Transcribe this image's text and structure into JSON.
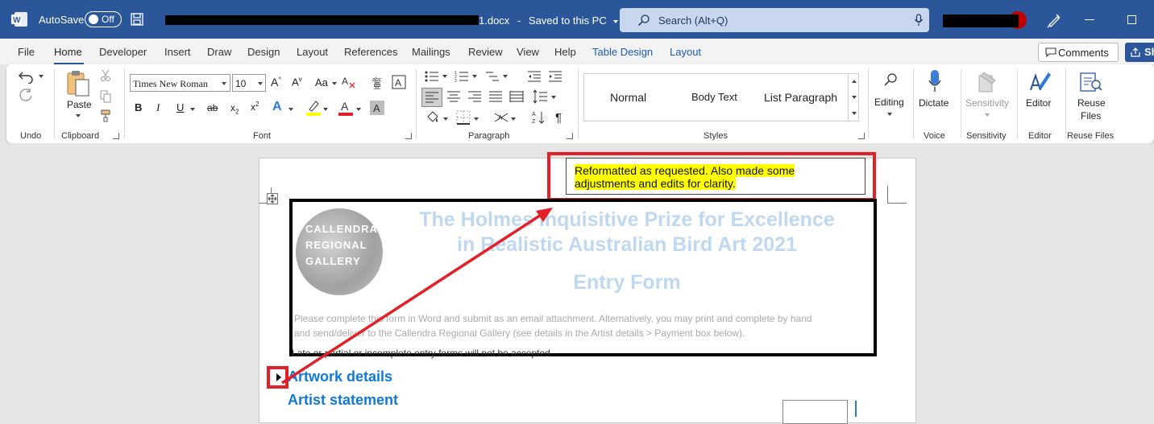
{
  "titlebar": {
    "autosave_label": "AutoSave",
    "autosave_state": "Off",
    "doc_title_suffix": "1.docx",
    "save_status": "Saved to this PC",
    "search_placeholder": "Search (Alt+Q)",
    "colors": {
      "bar": "#2b579a",
      "search": "#c8d6ee"
    }
  },
  "tabs": {
    "items": [
      "File",
      "Home",
      "Developer",
      "Insert",
      "Draw",
      "Design",
      "Layout",
      "References",
      "Mailings",
      "Review",
      "View",
      "Help",
      "Table Design",
      "Layout"
    ],
    "active": "Home",
    "comments_label": "Comments",
    "share_label": "Sh"
  },
  "ribbon": {
    "groups": {
      "undo": "Undo",
      "clipboard": "Clipboard",
      "font": "Font",
      "paragraph": "Paragraph",
      "styles": "Styles",
      "voice": "Voice",
      "sensitivity": "Sensitivity",
      "editor": "Editor",
      "reuse_files": "Reuse Files"
    },
    "paste_label": "Paste",
    "font_name": "Times New Roman",
    "font_size": "10",
    "styles": [
      "Normal",
      "Body Text",
      "List Paragraph"
    ],
    "buttons": {
      "editing": "Editing",
      "dictate": "Dictate",
      "sensitivity": "Sensitivity",
      "editor": "Editor",
      "reuse_files_line1": "Reuse",
      "reuse_files_line2": "Files"
    },
    "icons": [
      "undo-icon",
      "redo-icon",
      "paste-icon",
      "cut-icon",
      "copy-icon",
      "format-painter-icon",
      "bold-icon",
      "italic-icon",
      "underline-icon",
      "strikethrough-icon",
      "subscript-icon",
      "superscript-icon",
      "text-effects-icon",
      "highlight-icon",
      "font-color-icon",
      "bullets-icon",
      "numbering-icon",
      "multilevel-list-icon",
      "align-left-icon",
      "center-icon",
      "align-right-icon",
      "justify-icon",
      "line-spacing-icon",
      "shading-icon",
      "borders-icon",
      "sort-icon",
      "show-formatting-icon",
      "find-icon",
      "microphone-icon",
      "editor-pen-icon"
    ]
  },
  "document": {
    "comment_text": "Reformatted as requested. Also made some adjustments and edits for clarity.",
    "faded_title_line1": "The Holmes Inquisitive Prize for Excellence",
    "faded_title_line2": "in Realistic Australian Bird Art 2021",
    "faded_subtitle": "Entry Form",
    "faded_logo_lines": [
      "CALLENDRA",
      "REGIONAL",
      "GALLERY"
    ],
    "faded_para_line1": "Please complete this form in Word and submit as an email attachment. Alternatively, you may print and complete by hand",
    "faded_para_line2": "and send/deliver to the Callendra Regional Gallery (see details in the Artist details > Payment box below).",
    "below_frame_text": "Late or partial or incomplete entry forms will not be accepted.",
    "heading_artwork": "Artwork details",
    "heading_artist": "Artist statement",
    "colors": {
      "heading": "#0f7ad8",
      "highlight": "#ffff00",
      "annotation": "#e32028"
    }
  }
}
